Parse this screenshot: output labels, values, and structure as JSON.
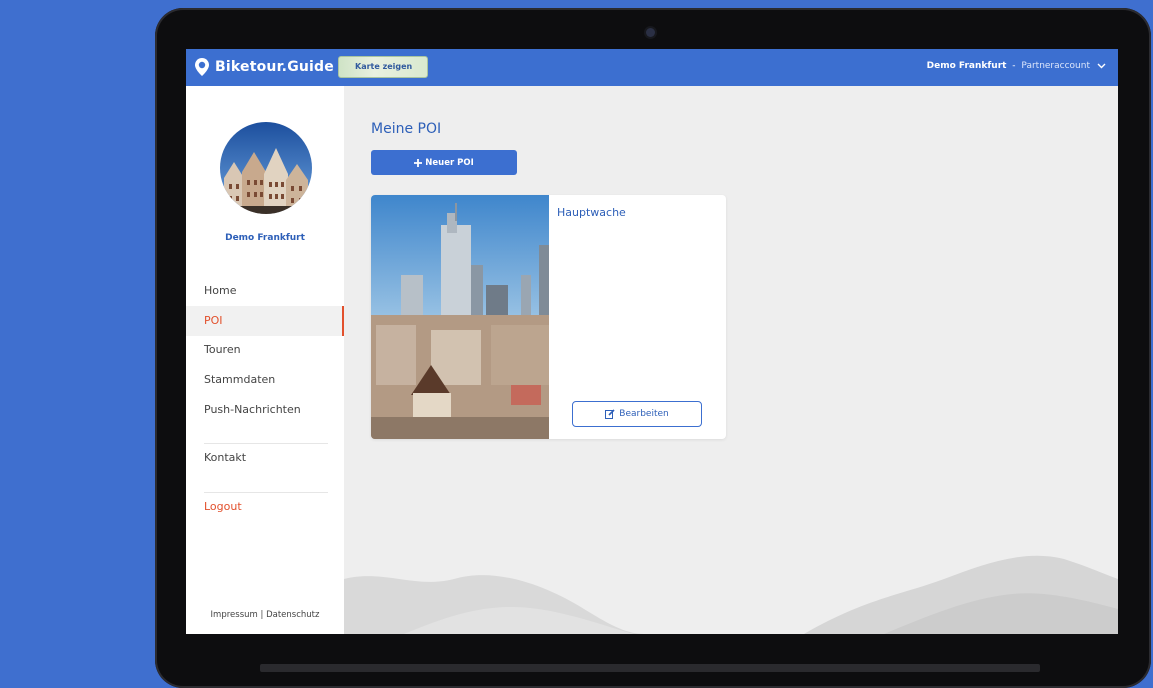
{
  "header": {
    "brand": "Biketour.Guide",
    "map_button": "Karte zeigen",
    "account_name": "Demo Frankfurt",
    "account_separator": " - ",
    "account_role": "Partneraccount"
  },
  "sidebar": {
    "profile_name": "Demo Frankfurt",
    "items": [
      {
        "label": "Home"
      },
      {
        "label": "POI"
      },
      {
        "label": "Touren"
      },
      {
        "label": "Stammdaten"
      },
      {
        "label": "Push-Nachrichten"
      },
      {
        "label": "Kontakt"
      },
      {
        "label": "Logout"
      }
    ],
    "active": "POI",
    "footer_impressum": "Impressum",
    "footer_separator": " | ",
    "footer_datenschutz": "Datenschutz"
  },
  "main": {
    "title": "Meine POI",
    "new_button": "Neuer POI",
    "cards": [
      {
        "title": "Hauptwache",
        "edit_label": "Bearbeiten"
      }
    ]
  },
  "colors": {
    "brand_blue": "#3c6fd0",
    "accent_orange": "#e2502c",
    "background": "#3f6fcf"
  },
  "icons": {
    "logo": "map-pin-icon",
    "account_menu": "chevron-down-icon",
    "new_button": "plus-icon",
    "edit_button": "edit-icon"
  }
}
